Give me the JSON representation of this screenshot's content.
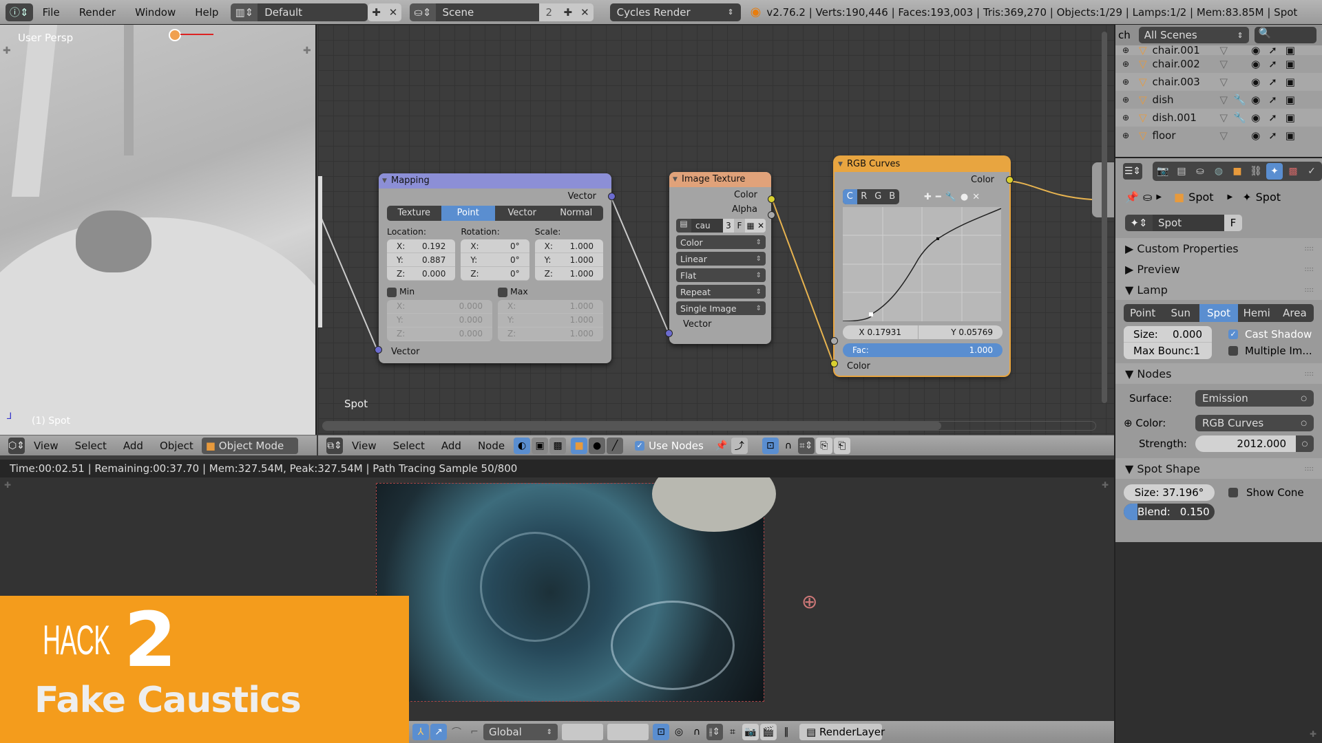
{
  "topbar": {
    "info_icon": "info-icon",
    "menus": [
      "File",
      "Render",
      "Window",
      "Help"
    ],
    "screen_layout": "Default",
    "scene": "Scene",
    "scene_users": "2",
    "render_engine": "Cycles Render",
    "stats": "v2.76.2 | Verts:190,446 | Faces:193,003 | Tris:369,270 | Objects:1/29 | Lamps:1/2 | Mem:83.85M | Spot"
  },
  "viewport": {
    "view_name": "User Persp",
    "object_label": "(1) Spot",
    "header": {
      "menus": [
        "View",
        "Select",
        "Add",
        "Object"
      ],
      "mode": "Object Mode"
    }
  },
  "node_editor": {
    "object_label": "Spot",
    "header": {
      "menus": [
        "View",
        "Select",
        "Add",
        "Node"
      ],
      "use_nodes_label": "Use Nodes",
      "use_nodes_checked": true
    },
    "mapping": {
      "title": "Mapping",
      "output": "Vector",
      "tabs": [
        "Texture",
        "Point",
        "Vector",
        "Normal"
      ],
      "active_tab": "Point",
      "location_label": "Location:",
      "rotation_label": "Rotation:",
      "scale_label": "Scale:",
      "location": [
        {
          "axis": "X:",
          "value": "0.192"
        },
        {
          "axis": "Y:",
          "value": "0.887"
        },
        {
          "axis": "Z:",
          "value": "0.000"
        }
      ],
      "rotation": [
        {
          "axis": "X:",
          "value": "0°"
        },
        {
          "axis": "Y:",
          "value": "0°"
        },
        {
          "axis": "Z:",
          "value": "0°"
        }
      ],
      "scale": [
        {
          "axis": "X:",
          "value": "1.000"
        },
        {
          "axis": "Y:",
          "value": "1.000"
        },
        {
          "axis": "Z:",
          "value": "1.000"
        }
      ],
      "min_label": "Min",
      "max_label": "Max",
      "min": [
        {
          "axis": "X:",
          "value": "0.000"
        },
        {
          "axis": "Y:",
          "value": "0.000"
        },
        {
          "axis": "Z:",
          "value": "0.000"
        }
      ],
      "max": [
        {
          "axis": "X:",
          "value": "1.000"
        },
        {
          "axis": "Y:",
          "value": "1.000"
        },
        {
          "axis": "Z:",
          "value": "1.000"
        }
      ],
      "input": "Vector"
    },
    "image_texture": {
      "title": "Image Texture",
      "outputs": [
        "Color",
        "Alpha"
      ],
      "image_name": "cau",
      "image_users": "3",
      "fake_user": "F",
      "dropdowns": [
        "Color",
        "Linear",
        "Flat",
        "Repeat",
        "Single Image"
      ],
      "input": "Vector"
    },
    "rgb_curves": {
      "title": "RGB Curves",
      "output": "Color",
      "channels": [
        "C",
        "R",
        "G",
        "B"
      ],
      "active_channel": "C",
      "point_x": "X 0.17931",
      "point_y": "Y 0.05769",
      "fac_label": "Fac:",
      "fac_value": "1.000",
      "input": "Color"
    }
  },
  "outliner": {
    "filter": "All Scenes",
    "search_label": "ch",
    "items": [
      {
        "name": "chair.001",
        "has_modifier": false
      },
      {
        "name": "chair.002",
        "has_modifier": false
      },
      {
        "name": "chair.003",
        "has_modifier": false
      },
      {
        "name": "dish",
        "has_modifier": true
      },
      {
        "name": "dish.001",
        "has_modifier": true
      },
      {
        "name": "floor",
        "has_modifier": false
      }
    ]
  },
  "properties": {
    "breadcrumb": [
      "Spot",
      "Spot"
    ],
    "datablock": "Spot",
    "fake_user": "F",
    "sections": {
      "custom_properties": "Custom Properties",
      "preview": "Preview",
      "lamp": "Lamp",
      "nodes": "Nodes",
      "spot_shape": "Spot Shape"
    },
    "lamp_types": [
      "Point",
      "Sun",
      "Spot",
      "Hemi",
      "Area"
    ],
    "active_lamp_type": "Spot",
    "size_label": "Size:",
    "size_value": "0.000",
    "max_bounce": "Max Bounc:1",
    "cast_shadow_label": "Cast Shadow",
    "cast_shadow": true,
    "multiple_importance_label": "Multiple Im...",
    "multiple_importance": false,
    "surface_label": "Surface:",
    "surface_value": "Emission",
    "color_label": "Color:",
    "color_value": "RGB Curves",
    "strength_label": "Strength:",
    "strength_value": "2012.000",
    "spot_size": "Size: 37.196°",
    "show_cone_label": "Show Cone",
    "show_cone": false,
    "blend_label": "Blend:",
    "blend_value": "0.150",
    "blend_fraction": 0.15
  },
  "render": {
    "status": "Time:00:02.51 | Remaining:00:37.70 | Mem:327.54M, Peak:327.54M | Path Tracing Sample 50/800",
    "bottom_bar": {
      "orientation": "Global",
      "render_layer": "RenderLayer"
    }
  },
  "overlay": {
    "hack_label": "HACK",
    "hack_number": "2",
    "title": "Fake Caustics",
    "color": "#f49c1c"
  },
  "colors": {
    "accent_blue": "#5a8ed0",
    "mapping_header": "#8c8fd6",
    "texture_header": "#e0a27a",
    "curves_header": "#e8a540"
  }
}
